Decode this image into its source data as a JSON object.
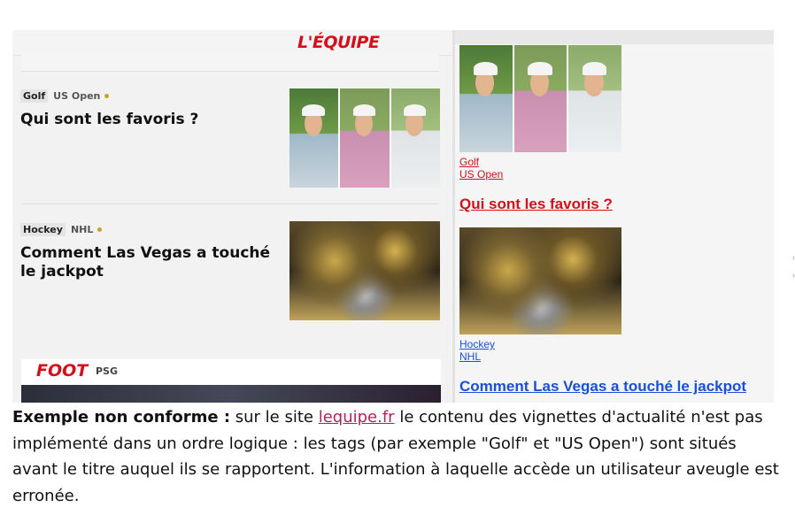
{
  "left_panel": {
    "logo": "L'ÉQUIPE",
    "articles": [
      {
        "tag": "Golf",
        "subtag": "US Open",
        "title": "Qui sont les favoris ?",
        "image": "golfers-photo"
      },
      {
        "tag": "Hockey",
        "subtag": "NHL",
        "title": "Comment Las Vegas a touché le jackpot",
        "image": "hockey-team-photo"
      }
    ],
    "section": {
      "name": "FOOT",
      "subtag": "PSG"
    }
  },
  "right_panel": {
    "articles": [
      {
        "tag": "Golf",
        "subtag": "US Open",
        "title": "Qui sont les favoris ?"
      },
      {
        "tag": "Hockey",
        "subtag": "NHL",
        "title": "Comment Las Vegas a touché le jackpot"
      }
    ]
  },
  "caption": {
    "label": "Exemple non conforme :",
    "before_link": "sur le site",
    "link": "lequipe.fr",
    "after_link": "le contenu des vignettes d'actualité n'est pas implémenté dans un ordre logique : les tags (par exemple \"Golf\" et \"US Open\") sont situés avant le titre auquel ils se rapportent. L'information à laquelle accède un utilisateur aveugle est erronée."
  },
  "colors": {
    "brand_red": "#d20f1a",
    "link_blue": "#1a4fd6",
    "tag_gold": "#c9a227"
  }
}
